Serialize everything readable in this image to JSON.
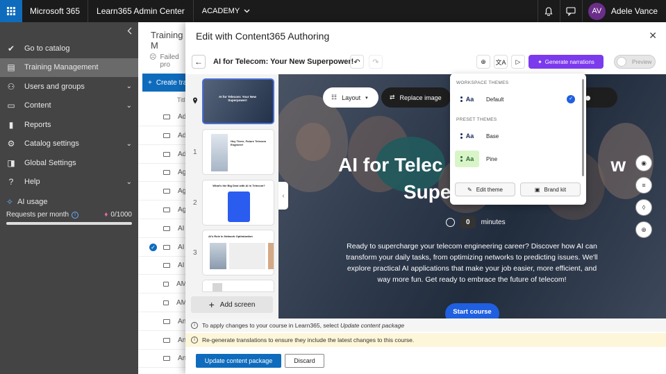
{
  "topbar": {
    "app_name": "Microsoft 365",
    "admin_center": "Learn365 Admin Center",
    "academy": "ACADEMY",
    "user_name": "Adele Vance",
    "user_initials": "AV"
  },
  "leftnav": {
    "items": [
      {
        "label": "Go to catalog",
        "icon": "catalog-icon"
      },
      {
        "label": "Training Management",
        "icon": "training-icon",
        "active": true
      },
      {
        "label": "Users and groups",
        "icon": "users-icon",
        "expandable": true
      },
      {
        "label": "Content",
        "icon": "folder-icon",
        "expandable": true
      },
      {
        "label": "Reports",
        "icon": "chart-icon"
      },
      {
        "label": "Catalog settings",
        "icon": "gear-icon",
        "expandable": true
      },
      {
        "label": "Global Settings",
        "icon": "global-settings-icon"
      },
      {
        "label": "Help",
        "icon": "help-icon",
        "expandable": true
      }
    ],
    "ai_usage": "AI usage",
    "requests_label": "Requests per month",
    "requests_value": "0/1000"
  },
  "background": {
    "title": "Training M",
    "failed": "Failed pro",
    "create": "Create tra",
    "col_title": "Title",
    "rows": [
      "Ad",
      "Ad",
      "Ad",
      "Ag",
      "Ag",
      "Ag",
      "AI",
      "AI",
      "AI",
      "AM",
      "AM",
      "An",
      "An",
      "An"
    ]
  },
  "panel": {
    "title": "Edit with Content365 Authoring",
    "course_title": "AI for Telecom: Your New Superpower!",
    "generate_narrations": "Generate narrations",
    "preview": "Preview",
    "add_screen": "Add screen",
    "thumbs": [
      {
        "num": "",
        "title": "AI for Telecom: Your New Superpower!"
      },
      {
        "num": "1",
        "title": "Hey There, Future Telecom Engineer!"
      },
      {
        "num": "2",
        "title": "What's the Big Deal with AI in Telecom?"
      },
      {
        "num": "3",
        "title": "AI's Role in Network Optimization"
      }
    ]
  },
  "stage": {
    "layout_btn": "Layout",
    "replace_btn": "Replace image",
    "title_line1": "AI for Telec",
    "title_line1_end": "w",
    "title_line2": "Supe",
    "minutes_value": "0",
    "minutes_label": "minutes",
    "description": "Ready to supercharge your telecom engineering career? Discover how AI can transform your daily tasks, from optimizing networks to predicting issues. We'll explore practical AI applications that make your job easier, more efficient, and way more fun. Get ready to embrace the future of telecom!",
    "start_btn": "Start course"
  },
  "themes": {
    "workspace_label": "WORKSPACE THEMES",
    "preset_label": "PRESET THEMES",
    "workspace": [
      {
        "name": "Default",
        "swatch": "Aa",
        "bg": "#ffffff",
        "selected": true
      }
    ],
    "preset": [
      {
        "name": "Base",
        "swatch": "Aa",
        "bg": "#ffffff"
      },
      {
        "name": "Pine",
        "swatch": "Aa",
        "bg": "#d9f5c8"
      }
    ],
    "edit_theme": "Edit theme",
    "brand_kit": "Brand kit"
  },
  "footer": {
    "info1_prefix": "To apply changes to your course in Learn365, select ",
    "info1_em": "Update content package",
    "info2": "Re-generate translations to ensure they include the latest changes to this course.",
    "update_btn": "Update content package",
    "discard_btn": "Discard"
  },
  "colors": {
    "accent": "#0f6cbd",
    "generate": "#7c3aed",
    "start": "#1f5fe0"
  }
}
